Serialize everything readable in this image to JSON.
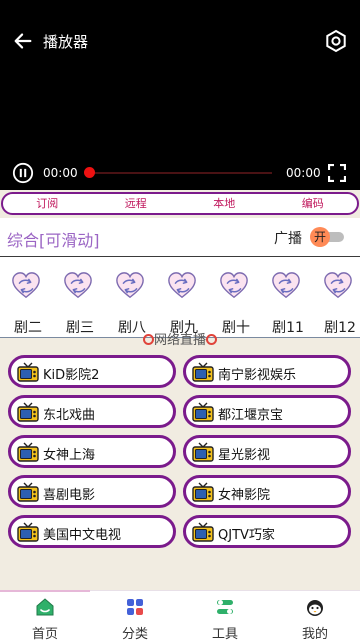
{
  "player": {
    "title": "播放器",
    "current_time": "00:00",
    "duration": "00:00",
    "progress": 0
  },
  "tabs": [
    "订阅",
    "远程",
    "本地",
    "编码"
  ],
  "category": {
    "title": "综合[可滑动]",
    "broadcast_label": "广播",
    "toggle_text": "开"
  },
  "channels": [
    "剧二",
    "剧三",
    "剧八",
    "剧九",
    "剧十",
    "剧11",
    "剧12"
  ],
  "section_title": "网络直播",
  "streams": [
    "KiD影院2",
    "南宁影视娱乐",
    "东北戏曲",
    "都江堰京宝",
    "女神上海",
    "星光影视",
    "喜剧电影",
    "女神影院",
    "美国中文电视",
    "QJTV巧家"
  ],
  "nav": [
    {
      "label": "首页",
      "icon": "home-icon"
    },
    {
      "label": "分类",
      "icon": "category-icon"
    },
    {
      "label": "工具",
      "icon": "tools-icon"
    },
    {
      "label": "我的",
      "icon": "profile-icon"
    }
  ],
  "colors": {
    "accent_purple": "#7b1b8c",
    "tab_text": "#c0185d",
    "seek_red": "#ee1111",
    "category_title": "#9b65c4"
  }
}
